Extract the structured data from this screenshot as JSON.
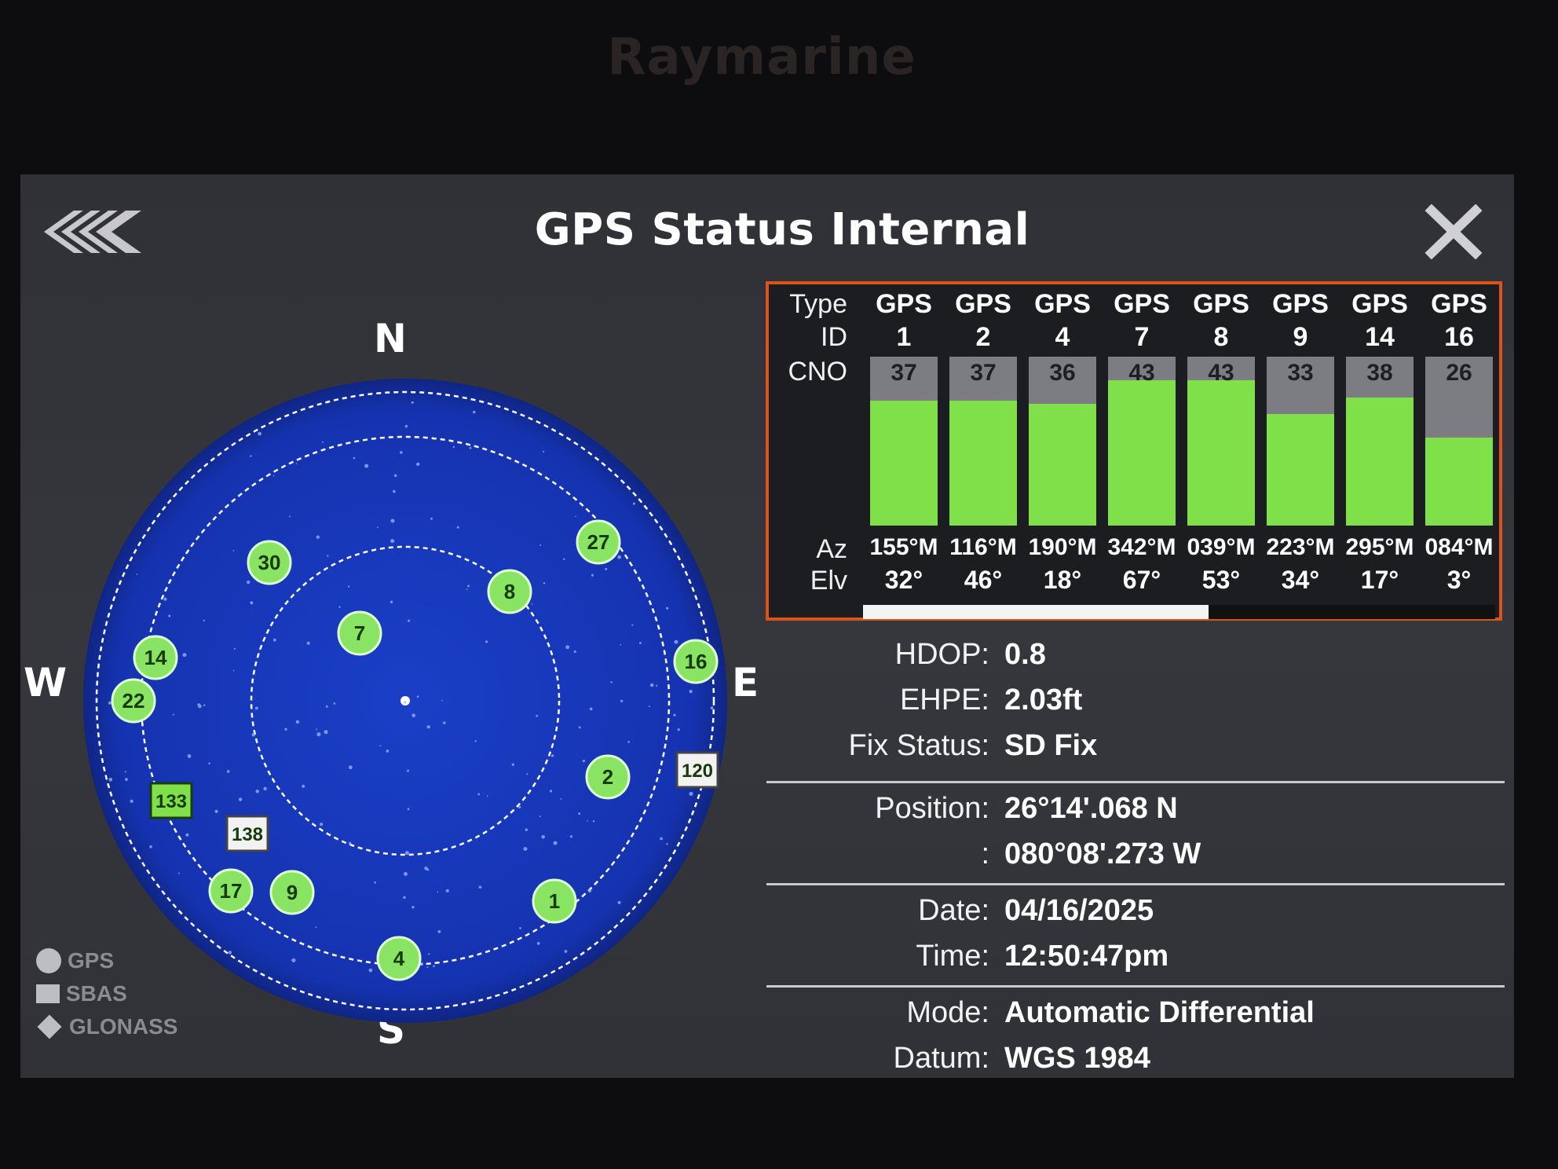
{
  "brand": "Raymarine",
  "header": {
    "title": "GPS Status Internal"
  },
  "sky_plot": {
    "compass": {
      "n": "N",
      "s": "S",
      "e": "E",
      "w": "W"
    },
    "satellites": [
      {
        "id": "27",
        "shape": "circle"
      },
      {
        "id": "30",
        "shape": "circle"
      },
      {
        "id": "8",
        "shape": "circle"
      },
      {
        "id": "7",
        "shape": "circle"
      },
      {
        "id": "14",
        "shape": "circle"
      },
      {
        "id": "16",
        "shape": "circle"
      },
      {
        "id": "22",
        "shape": "circle"
      },
      {
        "id": "120",
        "shape": "square-white"
      },
      {
        "id": "2",
        "shape": "circle"
      },
      {
        "id": "133",
        "shape": "square-green"
      },
      {
        "id": "138",
        "shape": "square-white"
      },
      {
        "id": "17",
        "shape": "circle"
      },
      {
        "id": "9",
        "shape": "circle"
      },
      {
        "id": "1",
        "shape": "circle"
      },
      {
        "id": "4",
        "shape": "circle"
      }
    ],
    "legend": [
      {
        "label": "GPS",
        "icon": "circle"
      },
      {
        "label": "SBAS",
        "icon": "square"
      },
      {
        "label": "GLONASS",
        "icon": "diamond"
      }
    ]
  },
  "table": {
    "labels": {
      "type": "Type",
      "id": "ID",
      "cno": "CNO",
      "az": "Az",
      "elv": "Elv"
    },
    "columns": [
      {
        "type": "GPS",
        "id": "1",
        "cno": "37",
        "az": "155°M",
        "elv": "32°"
      },
      {
        "type": "GPS",
        "id": "2",
        "cno": "37",
        "az": "116°M",
        "elv": "46°"
      },
      {
        "type": "GPS",
        "id": "4",
        "cno": "36",
        "az": "190°M",
        "elv": "18°"
      },
      {
        "type": "GPS",
        "id": "7",
        "cno": "43",
        "az": "342°M",
        "elv": "67°"
      },
      {
        "type": "GPS",
        "id": "8",
        "cno": "43",
        "az": "039°M",
        "elv": "53°"
      },
      {
        "type": "GPS",
        "id": "9",
        "cno": "33",
        "az": "223°M",
        "elv": "34°"
      },
      {
        "type": "GPS",
        "id": "14",
        "cno": "38",
        "az": "295°M",
        "elv": "17°"
      },
      {
        "type": "GPS",
        "id": "16",
        "cno": "26",
        "az": "084°M",
        "elv": "3°"
      }
    ],
    "cno_max": 50
  },
  "info": {
    "hdop": {
      "label": "HDOP:",
      "value": "0.8"
    },
    "ehpe": {
      "label": "EHPE:",
      "value": "2.03ft"
    },
    "fix": {
      "label": "Fix Status:",
      "value": "SD Fix"
    },
    "pos_lat": {
      "label": "Position:",
      "value": "26°14'.068 N"
    },
    "pos_lon": {
      "label": ":",
      "value": "080°08'.273 W"
    },
    "date": {
      "label": "Date:",
      "value": "04/16/2025"
    },
    "time": {
      "label": "Time:",
      "value": "12:50:47pm"
    },
    "mode": {
      "label": "Mode:",
      "value": "Automatic Differential"
    },
    "datum": {
      "label": "Datum:",
      "value": "WGS 1984"
    }
  },
  "colors": {
    "accent": "#d9531b",
    "bar_green": "#7fe04a",
    "sky_blue": "#1537b8"
  }
}
